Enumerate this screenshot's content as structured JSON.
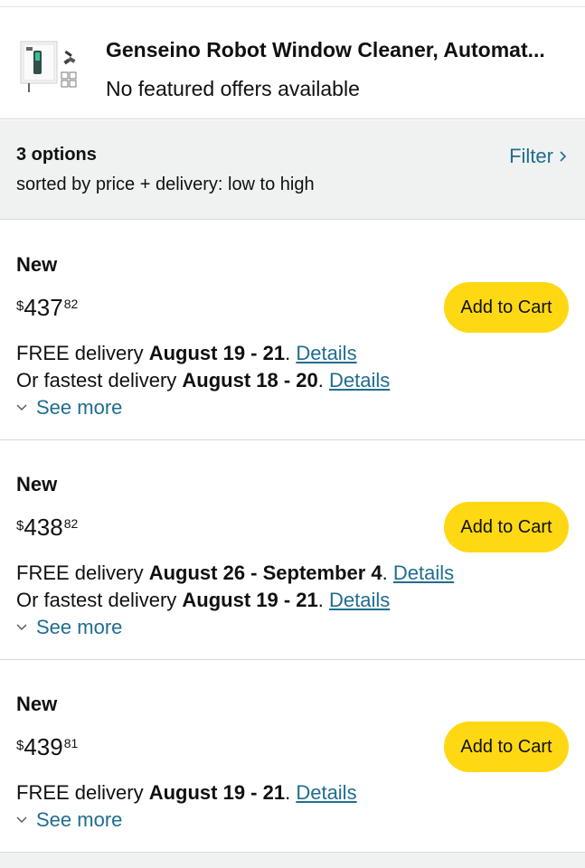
{
  "product": {
    "title": "Genseino Robot Window Cleaner, Automat...",
    "subtitle": "No featured offers available",
    "thumbnail_icon": "window-cleaner-product-image"
  },
  "summary": {
    "options_count": "3 options",
    "sort_text": "sorted by price + delivery: low to high",
    "filter_label": "Filter"
  },
  "offers": [
    {
      "condition": "New",
      "price_symbol": "$",
      "price_whole": "437",
      "price_fraction": "82",
      "cart_label": "Add to Cart",
      "delivery_prefix": "FREE delivery ",
      "delivery_dates": "August 19 - 21",
      "delivery_suffix": ". ",
      "delivery_link": "Details",
      "fastest_prefix": "Or fastest delivery ",
      "fastest_dates": "August 18 - 20",
      "fastest_suffix": ". ",
      "fastest_link": "Details",
      "see_more": "See more"
    },
    {
      "condition": "New",
      "price_symbol": "$",
      "price_whole": "438",
      "price_fraction": "82",
      "cart_label": "Add to Cart",
      "delivery_prefix": "FREE delivery ",
      "delivery_dates": "August 26 - September 4",
      "delivery_suffix": ". ",
      "delivery_link": "Details",
      "fastest_prefix": "Or fastest delivery ",
      "fastest_dates": "August 19 - 21",
      "fastest_suffix": ". ",
      "fastest_link": "Details",
      "see_more": "See more"
    },
    {
      "condition": "New",
      "price_symbol": "$",
      "price_whole": "439",
      "price_fraction": "81",
      "cart_label": "Add to Cart",
      "delivery_prefix": "FREE delivery ",
      "delivery_dates": "August 19 - 21",
      "delivery_suffix": ". ",
      "delivery_link": "Details",
      "see_more": "See more"
    }
  ],
  "colors": {
    "cart_button": "#ffd814",
    "link": "#1f6d8f",
    "summary_bg": "#f0f2f2"
  }
}
